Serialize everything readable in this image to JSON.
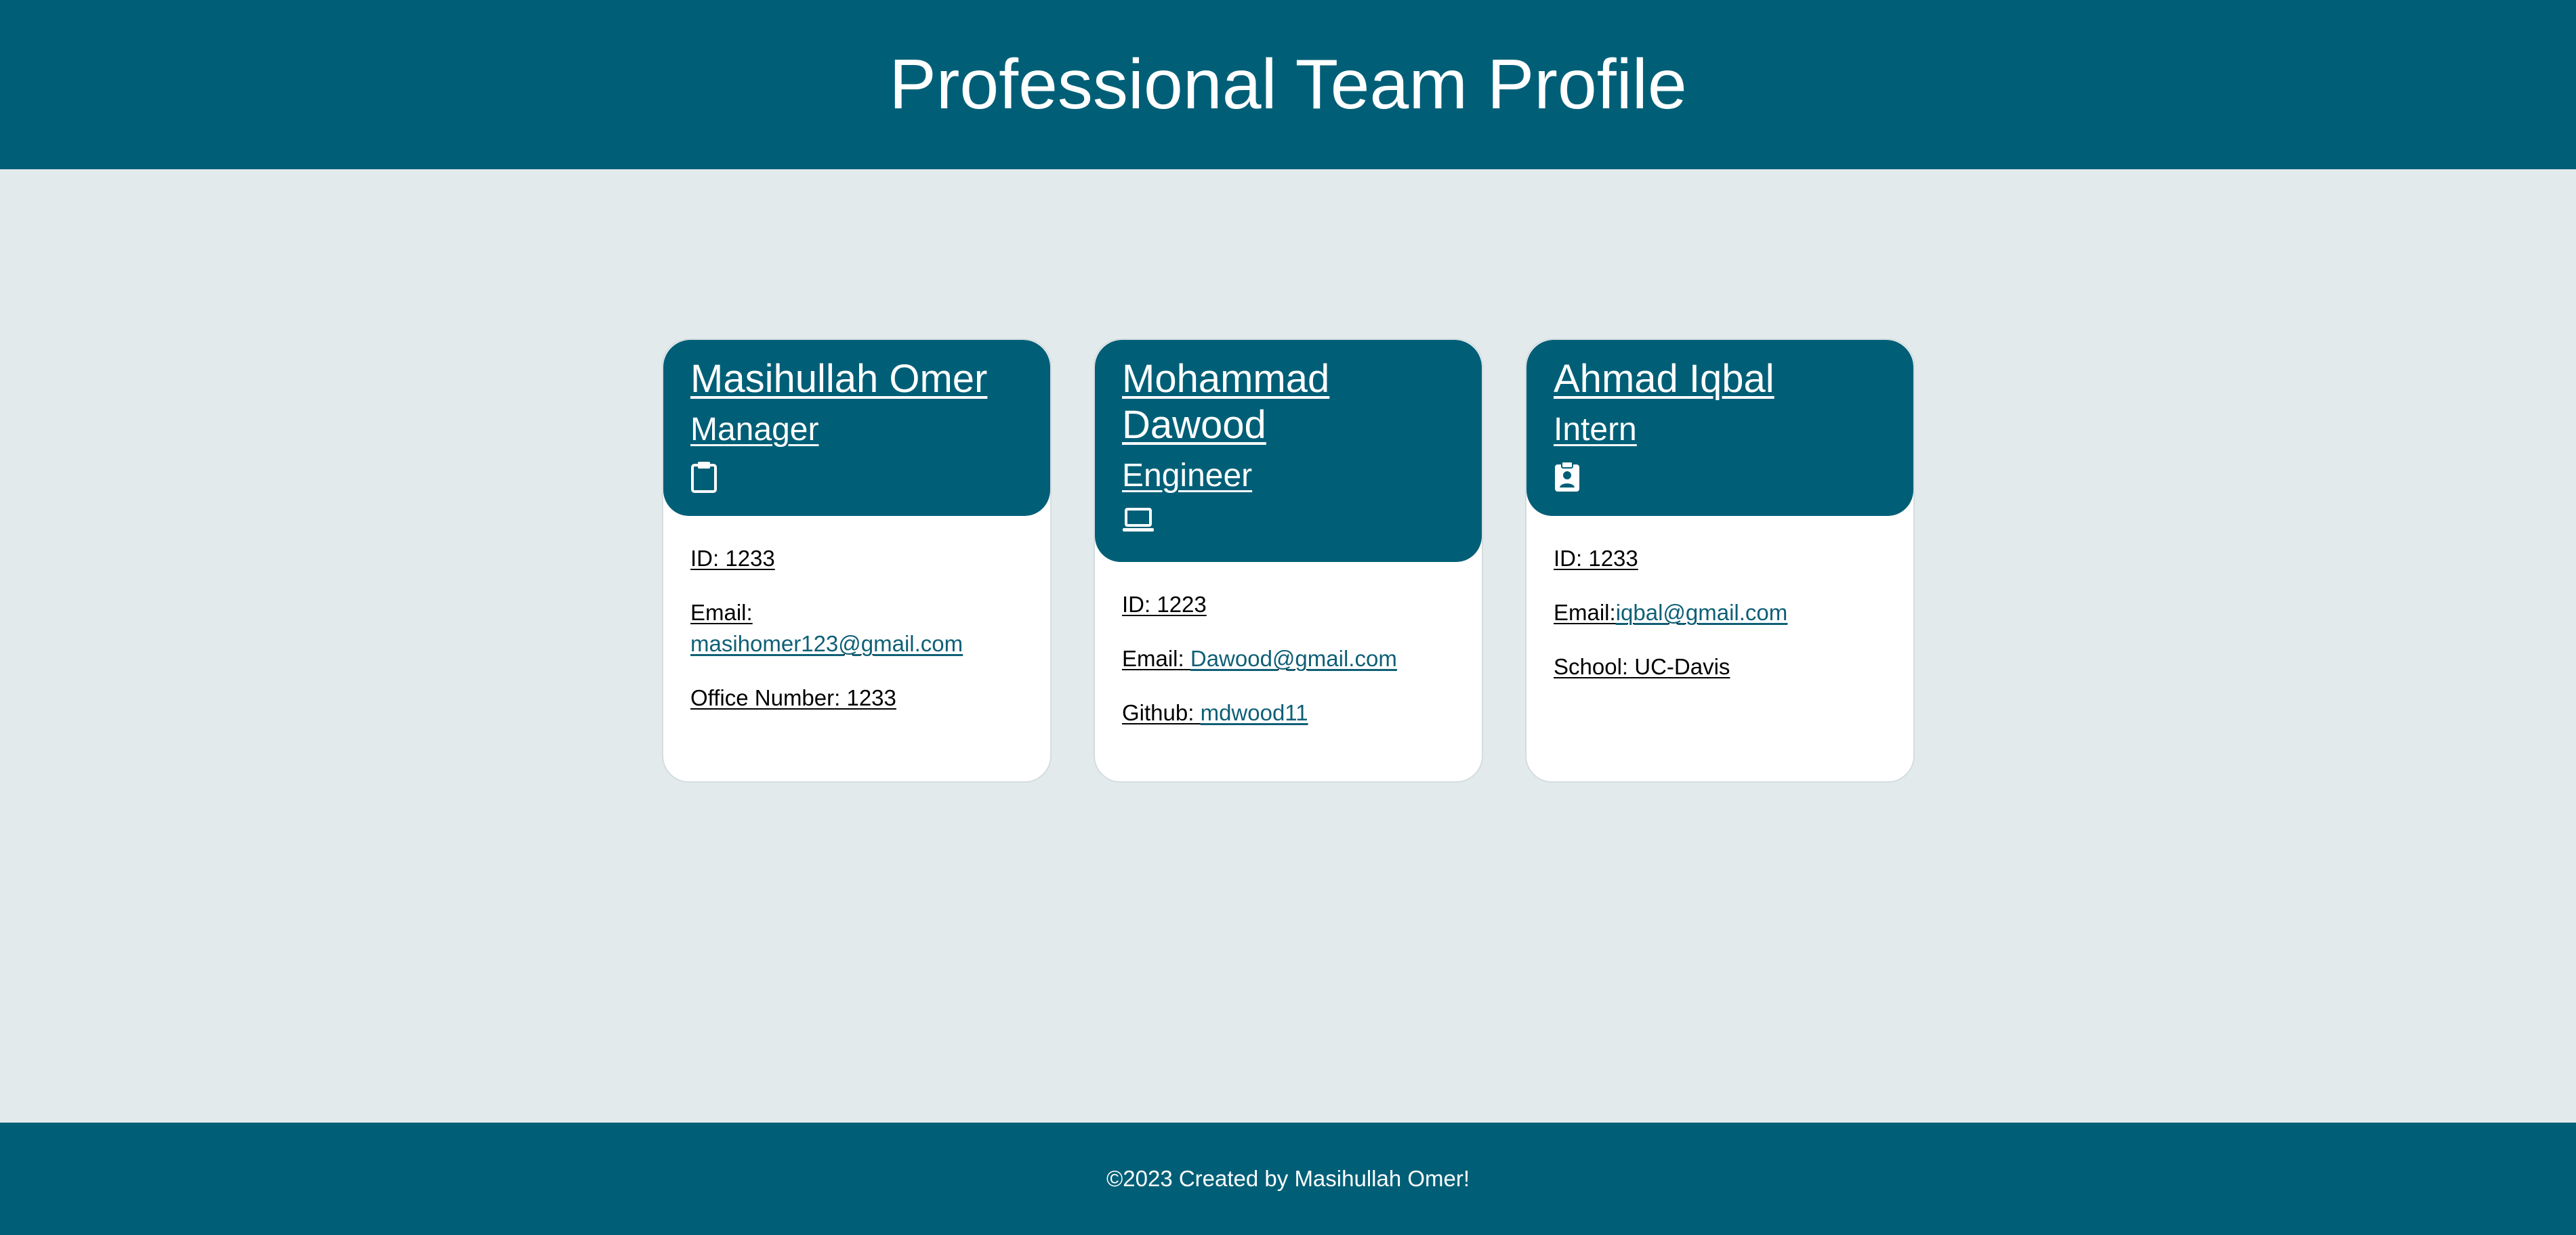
{
  "header": {
    "title": "Professional Team Profile"
  },
  "team": [
    {
      "name": "Masihullah Omer",
      "role": "Manager",
      "icon": "clipboard-icon",
      "id_line": "ID: 1233",
      "email_label": "Email:",
      "email": "masihomer123@gmail.com",
      "extra_line": "Office Number: 1233"
    },
    {
      "name": "Mohammad Dawood",
      "role": "Engineer",
      "icon": "laptop-icon",
      "id_line": "ID: 1223",
      "email_label": "Email:",
      "email": "Dawood@gmail.com",
      "extra_label": "Github:",
      "extra_link": "mdwood11"
    },
    {
      "name": "Ahmad Iqbal",
      "role": "Intern",
      "icon": "id-badge-icon",
      "id_line": "ID: 1233",
      "email_label": "Email:",
      "email": "iqbal@gmail.com",
      "extra_line": "School: UC-Davis"
    }
  ],
  "footer": {
    "text": "©2023 Created by Masihullah Omer!"
  },
  "colors": {
    "brand": "#005f77",
    "background": "#e2eaec",
    "link": "#0f5f76"
  }
}
